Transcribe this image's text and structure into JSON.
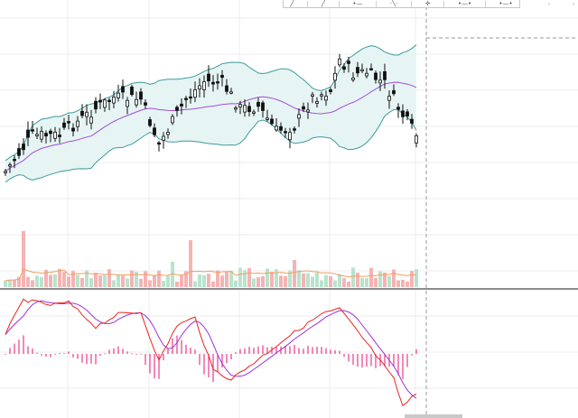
{
  "toolbar": {
    "tools": [
      {
        "name": "line-tool-icon",
        "glyph": "╱"
      },
      {
        "name": "ray-tool-icon",
        "glyph": "╱"
      },
      {
        "name": "horizontal-line-icon",
        "glyph": "•—"
      },
      {
        "name": "trend-angle-icon",
        "glyph": "·╲·"
      },
      {
        "name": "cross-line-icon",
        "glyph": "✛"
      },
      {
        "name": "horizontal-ray-icon",
        "glyph": "•—•"
      },
      {
        "name": "extended-line-icon",
        "glyph": "•—•"
      }
    ],
    "end_glyphs": [
      "◦",
      "◦"
    ]
  },
  "colors": {
    "up": "#5ab58c",
    "down": "#ef5350",
    "candle": "#111111",
    "bollinger": "#3f9b9b",
    "bollinger_fill": "#e6f4f4",
    "basis": "#a44ed8",
    "volume_ma": "#f0a060",
    "macd": "#ee2222",
    "signal": "#9a33dd",
    "histogram": "#e83b8a",
    "grid": "#ececec",
    "crosshair": "#999999"
  },
  "chart_data": {
    "type": "candlestick",
    "title": "",
    "xlabel": "",
    "ylabel": "",
    "grid": true,
    "series": [
      {
        "kind": "candles",
        "count": 92,
        "path": "down-up-down-up-down"
      },
      {
        "kind": "bollinger_bands"
      },
      {
        "kind": "volume"
      },
      {
        "kind": "macd"
      }
    ]
  }
}
